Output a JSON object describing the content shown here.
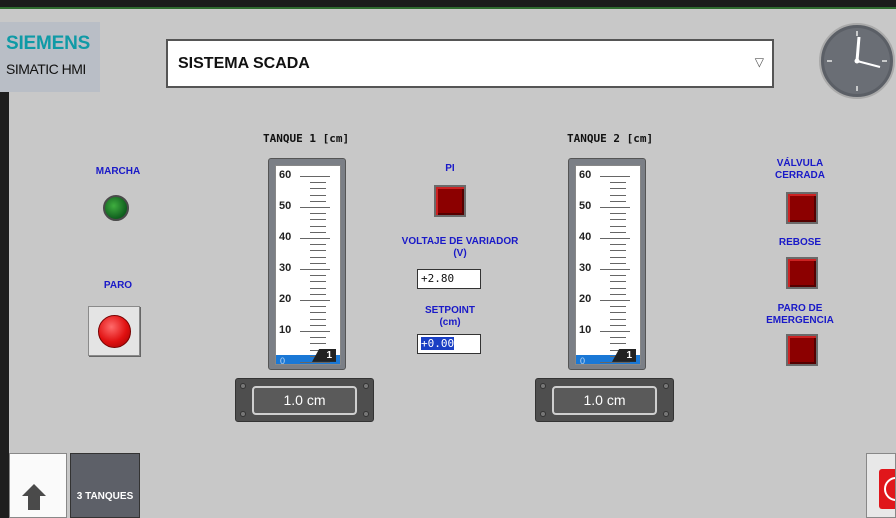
{
  "header": {
    "brand": "SIEMENS",
    "product": "SIMATIC HMI",
    "screen_select": "SISTEMA SCADA",
    "select_arrow": "▽"
  },
  "left": {
    "marcha_label": "MARCHA",
    "paro_label": "PARO"
  },
  "tank1": {
    "title": "TANQUE 1 [cm]",
    "ticks": [
      "60",
      "50",
      "40",
      "30",
      "20",
      "10",
      "0"
    ],
    "level": 1,
    "pointer": "1",
    "display": "1.0  cm"
  },
  "tank2": {
    "title": "TANQUE 2 [cm]",
    "ticks": [
      "60",
      "50",
      "40",
      "30",
      "20",
      "10",
      "0"
    ],
    "level": 1,
    "pointer": "1",
    "display": "1.0  cm"
  },
  "center": {
    "pi_label": "PI",
    "voltage_label_1": "VOLTAJE DE VARIADOR",
    "voltage_label_2": "(V)",
    "voltage_value": "+2.80",
    "setpoint_label_1": "SETPOINT",
    "setpoint_label_2": "(cm)",
    "setpoint_value": "+0.00"
  },
  "right": {
    "valve_label_1": "VÁLVULA",
    "valve_label_2": "CERRADA",
    "rebose_label": "REBOSE",
    "emergency_label_1": "PARO DE",
    "emergency_label_2": "EMERGENCIA"
  },
  "footer": {
    "tab_label": "3 TANQUES"
  },
  "colors": {
    "label_blue": "#1919c8",
    "indicator_off": "#8c0000",
    "tank_fill": "#1a78d6",
    "background": "#c8c8c8"
  },
  "icons": {
    "home": "home-icon",
    "exit": "power-icon",
    "dropdown": "chevron-down-icon",
    "clock": "clock-icon"
  }
}
